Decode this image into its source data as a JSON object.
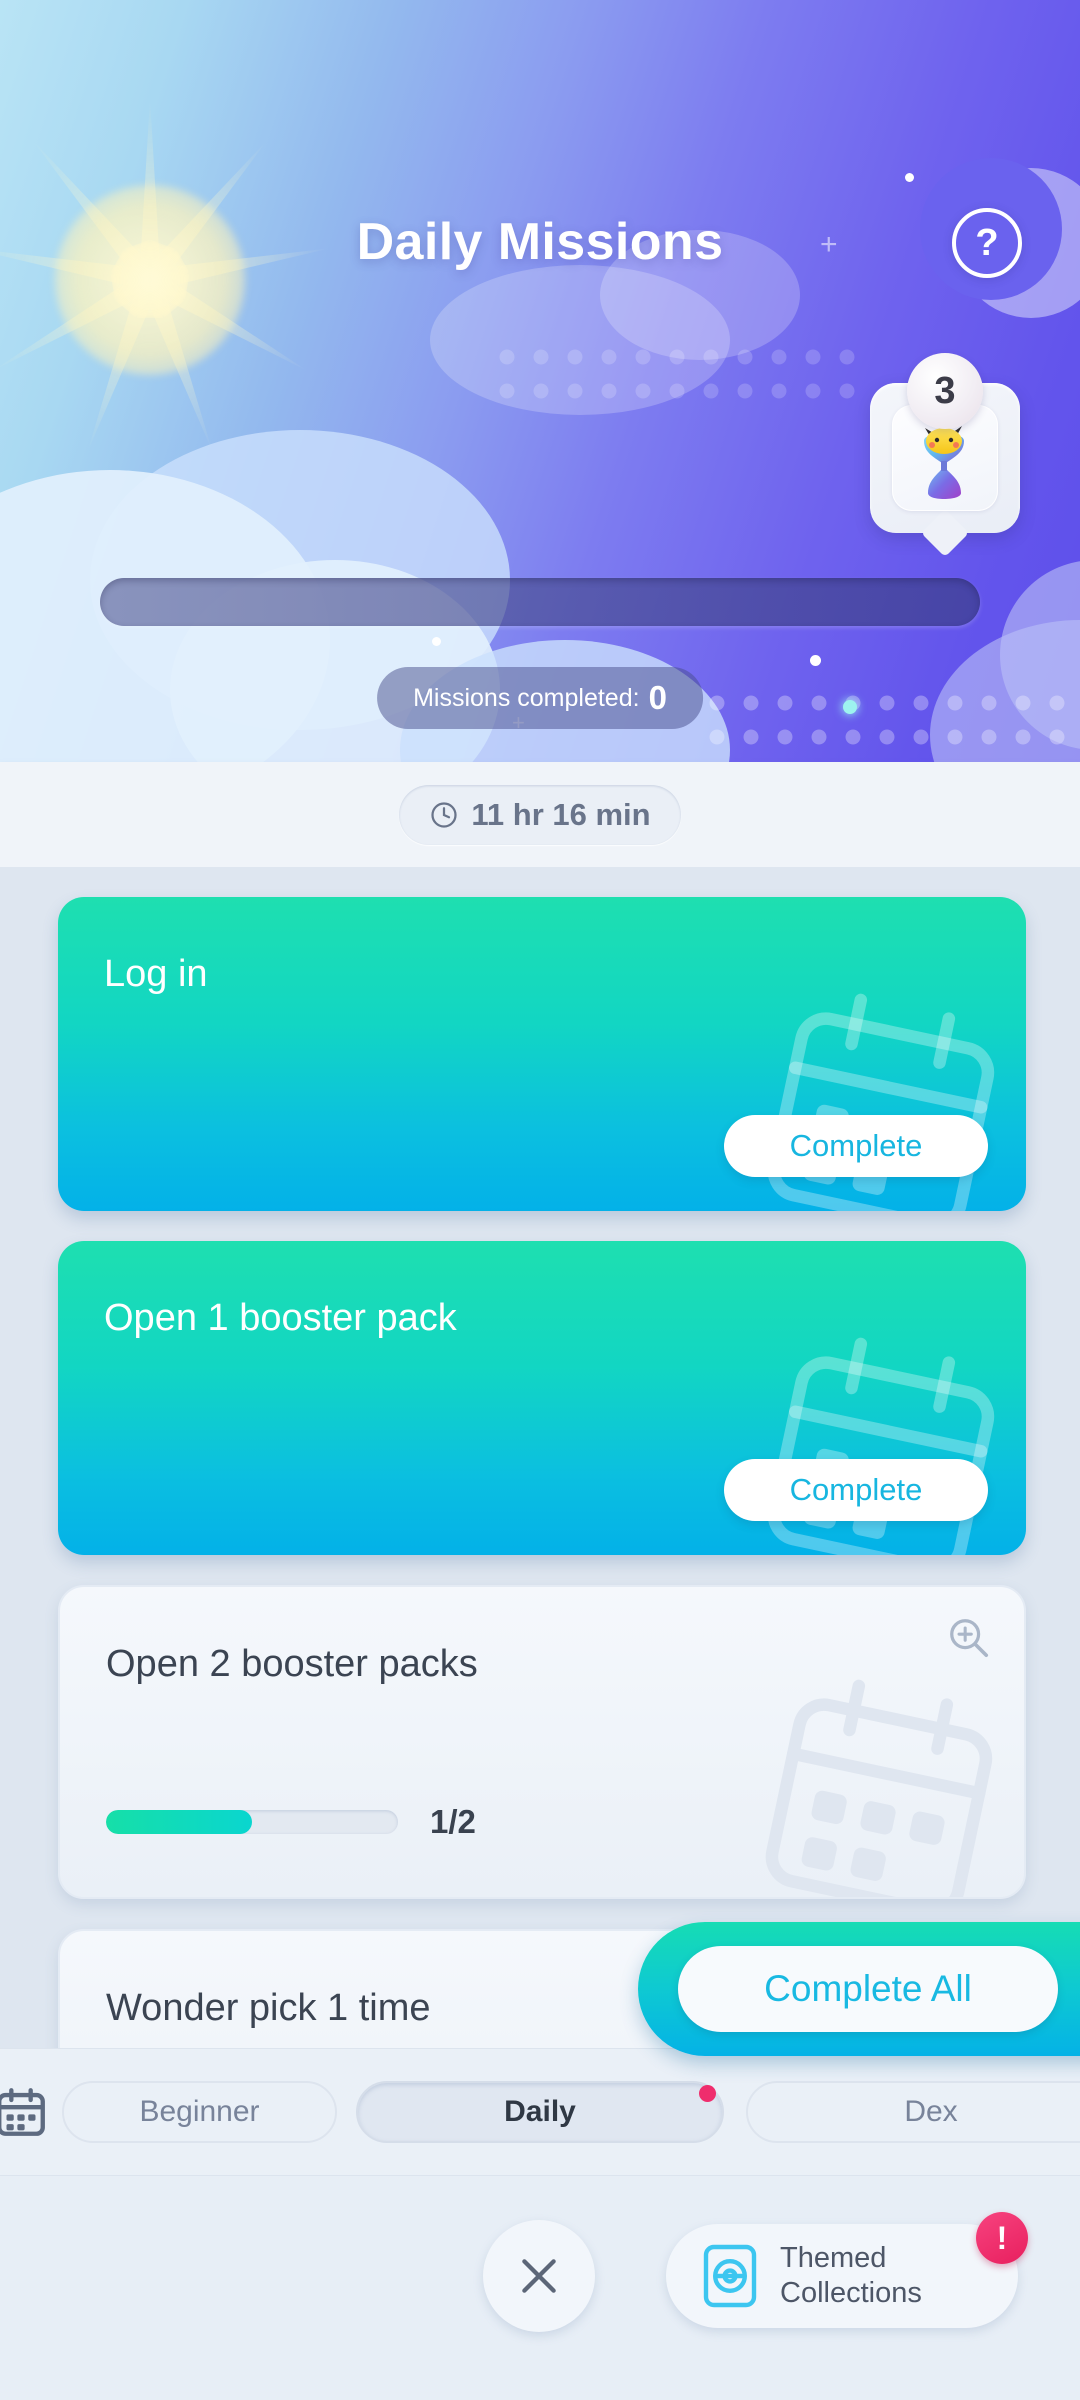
{
  "header": {
    "title": "Daily Missions",
    "help_icon": "question-mark-icon",
    "moon_icon": "crescent-moon-icon",
    "sun_icon": "sun-icon",
    "item_badge": {
      "count": "3",
      "item_icon": "hourglass-pikachu-icon"
    },
    "hero_progress": {
      "percent": 0,
      "fill_color": "#27e0b3"
    },
    "missions_completed_label": "Missions completed:",
    "missions_completed_value": "0"
  },
  "timer": {
    "icon": "clock-icon",
    "remaining": "11 hr 16 min"
  },
  "missions": [
    {
      "title": "Log in",
      "state": "claimable",
      "button_label": "Complete",
      "watermark_icon": "calendar-icon"
    },
    {
      "title": "Open 1 booster pack",
      "state": "claimable",
      "button_label": "Complete",
      "watermark_icon": "calendar-icon"
    },
    {
      "title": "Open 2 booster packs",
      "state": "in-progress",
      "progress_current": 1,
      "progress_total": 2,
      "progress_label": "1/2",
      "magnify_icon": "magnifier-plus-icon",
      "watermark_icon": "calendar-icon"
    },
    {
      "title": "Wonder pick 1 time",
      "state": "in-progress",
      "magnify_icon": "magnifier-plus-icon",
      "watermark_icon": "calendar-icon"
    }
  ],
  "complete_all": {
    "label": "Complete All",
    "accent": "#18b9e2"
  },
  "tabbar": {
    "leading_icon": "calendar-icon",
    "tabs": [
      {
        "label": "Beginner",
        "active": false,
        "badge": false
      },
      {
        "label": "Daily",
        "active": true,
        "badge": true
      },
      {
        "label": "Dex",
        "active": false,
        "badge": false
      }
    ],
    "badge_color": "#ef2d6d"
  },
  "bottombar": {
    "close_icon": "close-x-icon",
    "themed": {
      "icon": "pokeball-card-icon",
      "label_line1": "Themed",
      "label_line2": "Collections",
      "alert": "!",
      "alert_color": "#e81f5e"
    }
  }
}
